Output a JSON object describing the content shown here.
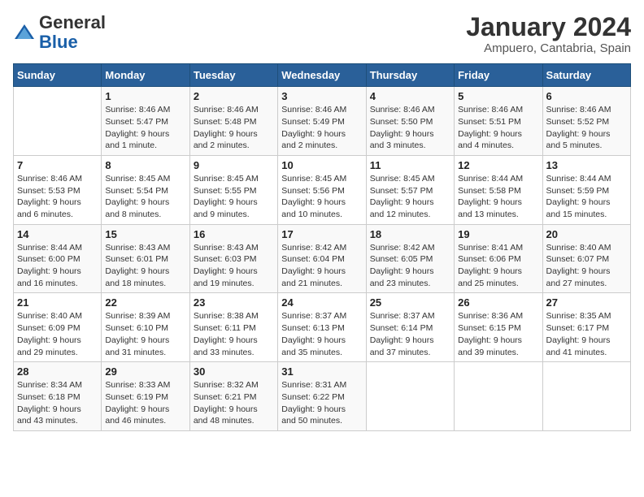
{
  "header": {
    "logo_general": "General",
    "logo_blue": "Blue",
    "month_year": "January 2024",
    "location": "Ampuero, Cantabria, Spain"
  },
  "weekdays": [
    "Sunday",
    "Monday",
    "Tuesday",
    "Wednesday",
    "Thursday",
    "Friday",
    "Saturday"
  ],
  "weeks": [
    [
      {
        "day": "",
        "info": ""
      },
      {
        "day": "1",
        "info": "Sunrise: 8:46 AM\nSunset: 5:47 PM\nDaylight: 9 hours\nand 1 minute."
      },
      {
        "day": "2",
        "info": "Sunrise: 8:46 AM\nSunset: 5:48 PM\nDaylight: 9 hours\nand 2 minutes."
      },
      {
        "day": "3",
        "info": "Sunrise: 8:46 AM\nSunset: 5:49 PM\nDaylight: 9 hours\nand 2 minutes."
      },
      {
        "day": "4",
        "info": "Sunrise: 8:46 AM\nSunset: 5:50 PM\nDaylight: 9 hours\nand 3 minutes."
      },
      {
        "day": "5",
        "info": "Sunrise: 8:46 AM\nSunset: 5:51 PM\nDaylight: 9 hours\nand 4 minutes."
      },
      {
        "day": "6",
        "info": "Sunrise: 8:46 AM\nSunset: 5:52 PM\nDaylight: 9 hours\nand 5 minutes."
      }
    ],
    [
      {
        "day": "7",
        "info": "Sunrise: 8:46 AM\nSunset: 5:53 PM\nDaylight: 9 hours\nand 6 minutes."
      },
      {
        "day": "8",
        "info": "Sunrise: 8:45 AM\nSunset: 5:54 PM\nDaylight: 9 hours\nand 8 minutes."
      },
      {
        "day": "9",
        "info": "Sunrise: 8:45 AM\nSunset: 5:55 PM\nDaylight: 9 hours\nand 9 minutes."
      },
      {
        "day": "10",
        "info": "Sunrise: 8:45 AM\nSunset: 5:56 PM\nDaylight: 9 hours\nand 10 minutes."
      },
      {
        "day": "11",
        "info": "Sunrise: 8:45 AM\nSunset: 5:57 PM\nDaylight: 9 hours\nand 12 minutes."
      },
      {
        "day": "12",
        "info": "Sunrise: 8:44 AM\nSunset: 5:58 PM\nDaylight: 9 hours\nand 13 minutes."
      },
      {
        "day": "13",
        "info": "Sunrise: 8:44 AM\nSunset: 5:59 PM\nDaylight: 9 hours\nand 15 minutes."
      }
    ],
    [
      {
        "day": "14",
        "info": "Sunrise: 8:44 AM\nSunset: 6:00 PM\nDaylight: 9 hours\nand 16 minutes."
      },
      {
        "day": "15",
        "info": "Sunrise: 8:43 AM\nSunset: 6:01 PM\nDaylight: 9 hours\nand 18 minutes."
      },
      {
        "day": "16",
        "info": "Sunrise: 8:43 AM\nSunset: 6:03 PM\nDaylight: 9 hours\nand 19 minutes."
      },
      {
        "day": "17",
        "info": "Sunrise: 8:42 AM\nSunset: 6:04 PM\nDaylight: 9 hours\nand 21 minutes."
      },
      {
        "day": "18",
        "info": "Sunrise: 8:42 AM\nSunset: 6:05 PM\nDaylight: 9 hours\nand 23 minutes."
      },
      {
        "day": "19",
        "info": "Sunrise: 8:41 AM\nSunset: 6:06 PM\nDaylight: 9 hours\nand 25 minutes."
      },
      {
        "day": "20",
        "info": "Sunrise: 8:40 AM\nSunset: 6:07 PM\nDaylight: 9 hours\nand 27 minutes."
      }
    ],
    [
      {
        "day": "21",
        "info": "Sunrise: 8:40 AM\nSunset: 6:09 PM\nDaylight: 9 hours\nand 29 minutes."
      },
      {
        "day": "22",
        "info": "Sunrise: 8:39 AM\nSunset: 6:10 PM\nDaylight: 9 hours\nand 31 minutes."
      },
      {
        "day": "23",
        "info": "Sunrise: 8:38 AM\nSunset: 6:11 PM\nDaylight: 9 hours\nand 33 minutes."
      },
      {
        "day": "24",
        "info": "Sunrise: 8:37 AM\nSunset: 6:13 PM\nDaylight: 9 hours\nand 35 minutes."
      },
      {
        "day": "25",
        "info": "Sunrise: 8:37 AM\nSunset: 6:14 PM\nDaylight: 9 hours\nand 37 minutes."
      },
      {
        "day": "26",
        "info": "Sunrise: 8:36 AM\nSunset: 6:15 PM\nDaylight: 9 hours\nand 39 minutes."
      },
      {
        "day": "27",
        "info": "Sunrise: 8:35 AM\nSunset: 6:17 PM\nDaylight: 9 hours\nand 41 minutes."
      }
    ],
    [
      {
        "day": "28",
        "info": "Sunrise: 8:34 AM\nSunset: 6:18 PM\nDaylight: 9 hours\nand 43 minutes."
      },
      {
        "day": "29",
        "info": "Sunrise: 8:33 AM\nSunset: 6:19 PM\nDaylight: 9 hours\nand 46 minutes."
      },
      {
        "day": "30",
        "info": "Sunrise: 8:32 AM\nSunset: 6:21 PM\nDaylight: 9 hours\nand 48 minutes."
      },
      {
        "day": "31",
        "info": "Sunrise: 8:31 AM\nSunset: 6:22 PM\nDaylight: 9 hours\nand 50 minutes."
      },
      {
        "day": "",
        "info": ""
      },
      {
        "day": "",
        "info": ""
      },
      {
        "day": "",
        "info": ""
      }
    ]
  ]
}
